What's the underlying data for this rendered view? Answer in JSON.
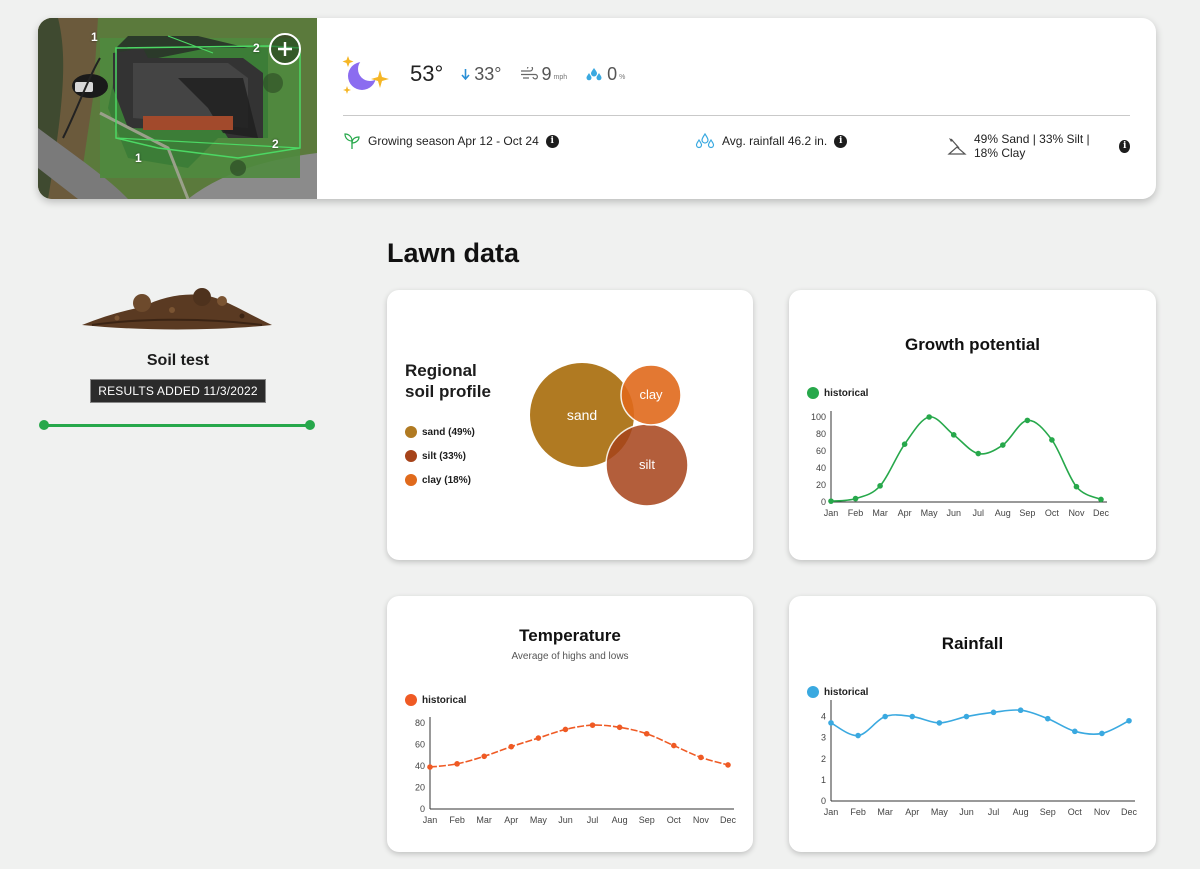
{
  "property": {
    "zone_labels": [
      "1",
      "2",
      "1",
      "2"
    ],
    "add_icon": "plus-icon"
  },
  "weather": {
    "icon": "moon-stars-icon",
    "temperature": "53°",
    "low": "33°",
    "wind_speed": "9",
    "wind_unit": "mph",
    "precip": "0",
    "precip_unit": "%"
  },
  "stats": {
    "growing_season": "Growing season Apr 12 - Oct 24",
    "rainfall": "Avg. rainfall 46.2 in.",
    "soil_mix": "49% Sand | 33% Silt | 18% Clay"
  },
  "soil_test": {
    "title": "Soil test",
    "badge": "RESULTS ADDED 11/3/2022"
  },
  "section_title": "Lawn data",
  "colors": {
    "green": "#27a84b",
    "orange": "#ef5a24",
    "blue": "#3aa9e0",
    "sand": "#b07a22",
    "silt": "#a6431a",
    "clay": "#e06a1c"
  },
  "soil_profile": {
    "title_line1": "Regional",
    "title_line2": "soil profile",
    "legend": [
      "sand (49%)",
      "silt (33%)",
      "clay (18%)"
    ],
    "bubble_labels": [
      "sand",
      "clay",
      "silt"
    ]
  },
  "chart_data": [
    {
      "type": "pie",
      "title": "Regional soil profile",
      "categories": [
        "sand",
        "silt",
        "clay"
      ],
      "values": [
        49,
        33,
        18
      ]
    },
    {
      "type": "line",
      "title": "Growth potential",
      "legend": "historical",
      "x": [
        "Jan",
        "Feb",
        "Mar",
        "Apr",
        "May",
        "Jun",
        "Jul",
        "Aug",
        "Sep",
        "Oct",
        "Nov",
        "Dec"
      ],
      "series": [
        {
          "name": "historical",
          "values": [
            1,
            4,
            19,
            68,
            100,
            79,
            57,
            67,
            96,
            73,
            18,
            3
          ]
        }
      ],
      "ylim": [
        0,
        100
      ],
      "yticks": [
        0,
        20,
        40,
        60,
        80,
        100
      ]
    },
    {
      "type": "line",
      "title": "Temperature",
      "subtitle": "Average of highs and lows",
      "legend": "historical",
      "x": [
        "Jan",
        "Feb",
        "Mar",
        "Apr",
        "May",
        "Jun",
        "Jul",
        "Aug",
        "Sep",
        "Oct",
        "Nov",
        "Dec"
      ],
      "series": [
        {
          "name": "historical",
          "values": [
            39,
            42,
            49,
            58,
            66,
            74,
            78,
            76,
            70,
            59,
            48,
            41
          ]
        }
      ],
      "ylim": [
        0,
        80
      ],
      "yticks": [
        0,
        20,
        40,
        60,
        80
      ]
    },
    {
      "type": "line",
      "title": "Rainfall",
      "legend": "historical",
      "x": [
        "Jan",
        "Feb",
        "Mar",
        "Apr",
        "May",
        "Jun",
        "Jul",
        "Aug",
        "Sep",
        "Oct",
        "Nov",
        "Dec"
      ],
      "series": [
        {
          "name": "historical",
          "values": [
            3.7,
            3.1,
            4.0,
            4.0,
            3.7,
            4.0,
            4.2,
            4.3,
            3.9,
            3.3,
            3.2,
            3.8
          ]
        }
      ],
      "ylim": [
        0,
        4.5
      ],
      "yticks": [
        0,
        1,
        2,
        3,
        4
      ]
    }
  ]
}
